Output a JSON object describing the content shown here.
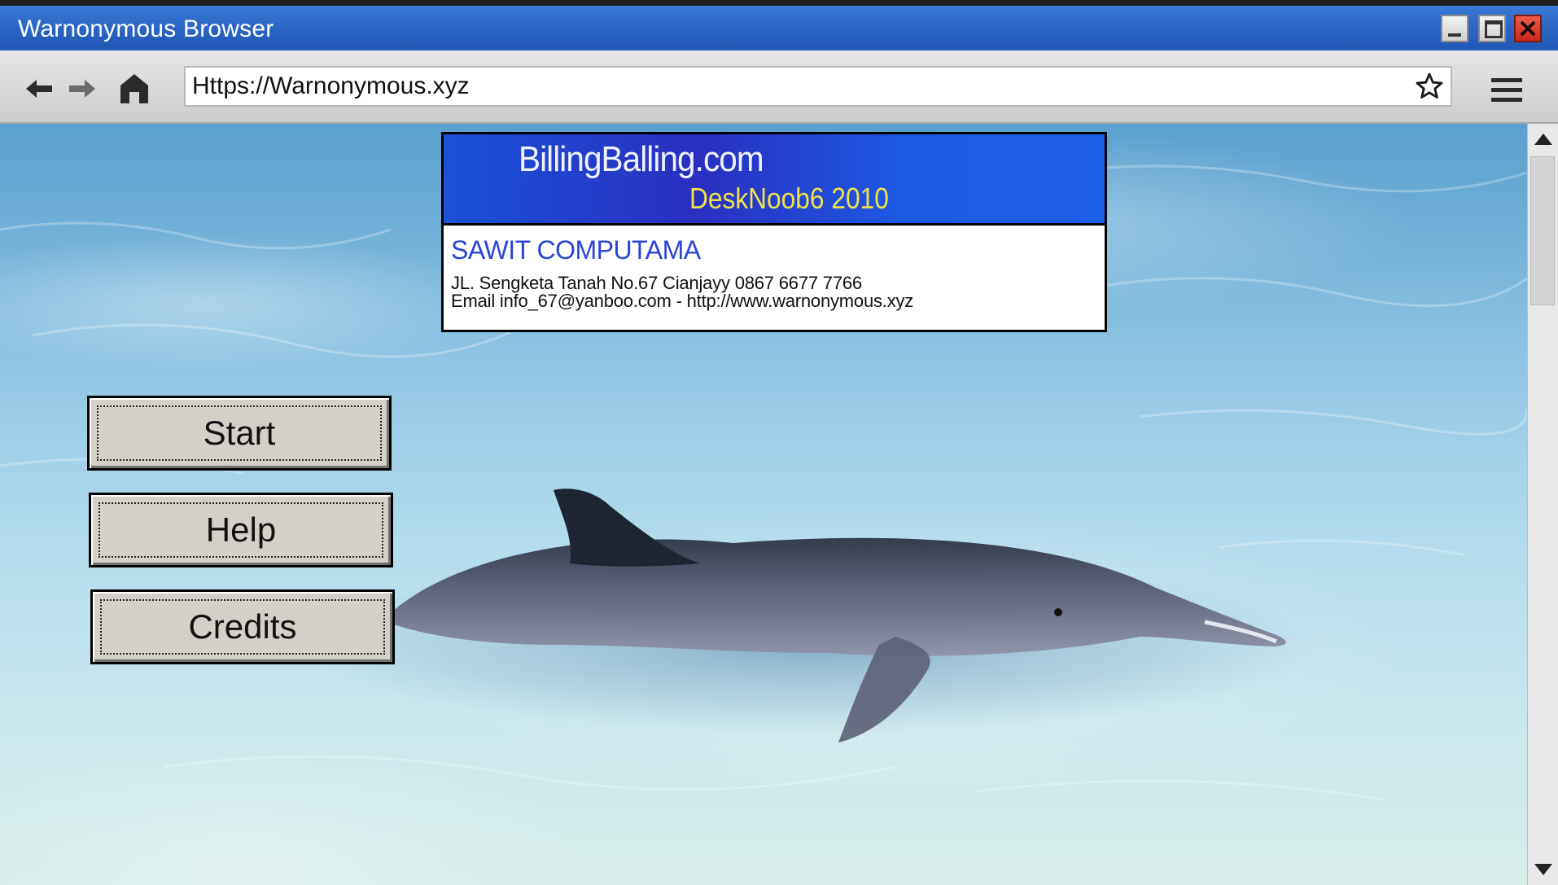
{
  "window": {
    "title": "Warnonymous Browser",
    "controls": [
      "minimize",
      "maximize",
      "close"
    ]
  },
  "toolbar": {
    "icons": [
      "back-arrow-icon",
      "forward-arrow-icon",
      "home-icon",
      "star-icon",
      "hamburger-menu-icon"
    ],
    "address": "Https://Warnonymous.xyz"
  },
  "banner": {
    "title": "BillingBalling.com",
    "subtitle": "DeskNoob6 2010",
    "company": "SAWIT COMPUTAMA",
    "address_line": "JL. Sengketa Tanah No.67 Cianjayy 0867 6677 7766",
    "email_line": "Email info_67@yanboo.com - http://www.warnonymous.xyz"
  },
  "menu": {
    "buttons": [
      {
        "label": "Start"
      },
      {
        "label": "Help"
      },
      {
        "label": "Credits"
      }
    ]
  },
  "colors": {
    "titlebar": "#2a63c2",
    "banner_blue": "#1d5ae4",
    "banner_subtitle": "#f0e24a",
    "company_text": "#2a44d8",
    "button_face": "#d4d0c8"
  }
}
